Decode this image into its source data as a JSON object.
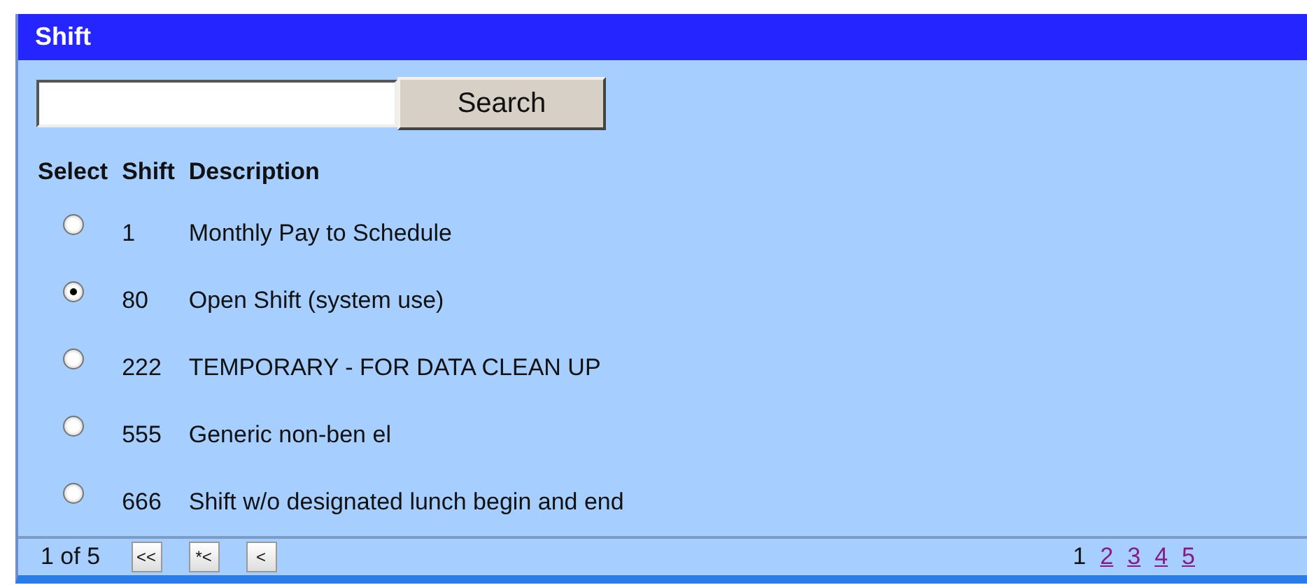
{
  "panel": {
    "title": "Shift"
  },
  "search": {
    "button": "Search"
  },
  "table": {
    "columns": [
      "Select",
      "Shift",
      "Description"
    ],
    "rows": [
      {
        "selected": false,
        "shift": "1",
        "description": "Monthly Pay to Schedule"
      },
      {
        "selected": true,
        "shift": "80",
        "description": "Open Shift (system use)"
      },
      {
        "selected": false,
        "shift": "222",
        "description": "TEMPORARY - FOR DATA CLEAN UP"
      },
      {
        "selected": false,
        "shift": "555",
        "description": "Generic non-ben el"
      },
      {
        "selected": false,
        "shift": "666",
        "description": "Shift w/o designated lunch begin and end"
      }
    ]
  },
  "pager": {
    "status": "1 of 5",
    "buttons": [
      "<<",
      "*<",
      "<"
    ],
    "pages": [
      {
        "label": "1",
        "selected": true
      },
      {
        "label": "2",
        "selected": false
      },
      {
        "label": "3",
        "selected": false
      },
      {
        "label": "4",
        "selected": false
      },
      {
        "label": "5",
        "selected": false
      }
    ]
  }
}
